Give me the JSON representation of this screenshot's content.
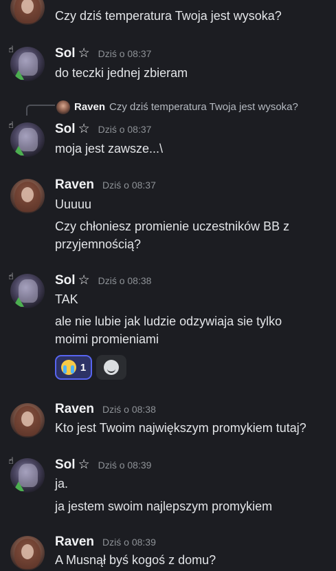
{
  "messages": [
    {
      "author": "",
      "time": "",
      "lines": [
        "Czy dziś temperatura Twoja jest wysoka?"
      ]
    },
    {
      "author": "Sol",
      "star": "☆",
      "time": "Dziś o 08:37",
      "lines": [
        "do teczki jednej zbieram"
      ]
    },
    {
      "reply": {
        "author": "Raven",
        "text": "Czy dziś temperatura Twoja jest wysoka?"
      },
      "author": "Sol",
      "star": "☆",
      "time": "Dziś o 08:37",
      "lines": [
        "moja jest zawsze...\\"
      ]
    },
    {
      "author": "Raven",
      "time": "Dziś o 08:37",
      "lines": [
        "Uuuuu",
        "Czy chłoniesz promienie uczestników BB z",
        "przyjemnością?"
      ]
    },
    {
      "author": "Sol",
      "star": "☆",
      "time": "Dziś o 08:38",
      "lines": [
        "TAK",
        "ale nie lubie jak ludzie odzywiaja sie tylko",
        "moimi promieniami"
      ],
      "reactions": [
        {
          "emoji": "sob-emoji",
          "count": "1"
        }
      ]
    },
    {
      "author": "Raven",
      "time": "Dziś o 08:38",
      "lines": [
        "Kto jest Twoim największym promykiem tutaj?"
      ]
    },
    {
      "author": "Sol",
      "star": "☆",
      "time": "Dziś o 08:39",
      "lines": [
        "ja.",
        "ja jestem swoim najlepszym promykiem"
      ]
    },
    {
      "author": "Raven",
      "time": "Dziś o 08:39",
      "lines": [
        "A Musnął byś kogoś z domu?"
      ]
    }
  ],
  "colors": {
    "background": "#1c1d22",
    "accent": "#5865f2",
    "username": "#f2f3f5",
    "timestamp": "#8e9297"
  }
}
